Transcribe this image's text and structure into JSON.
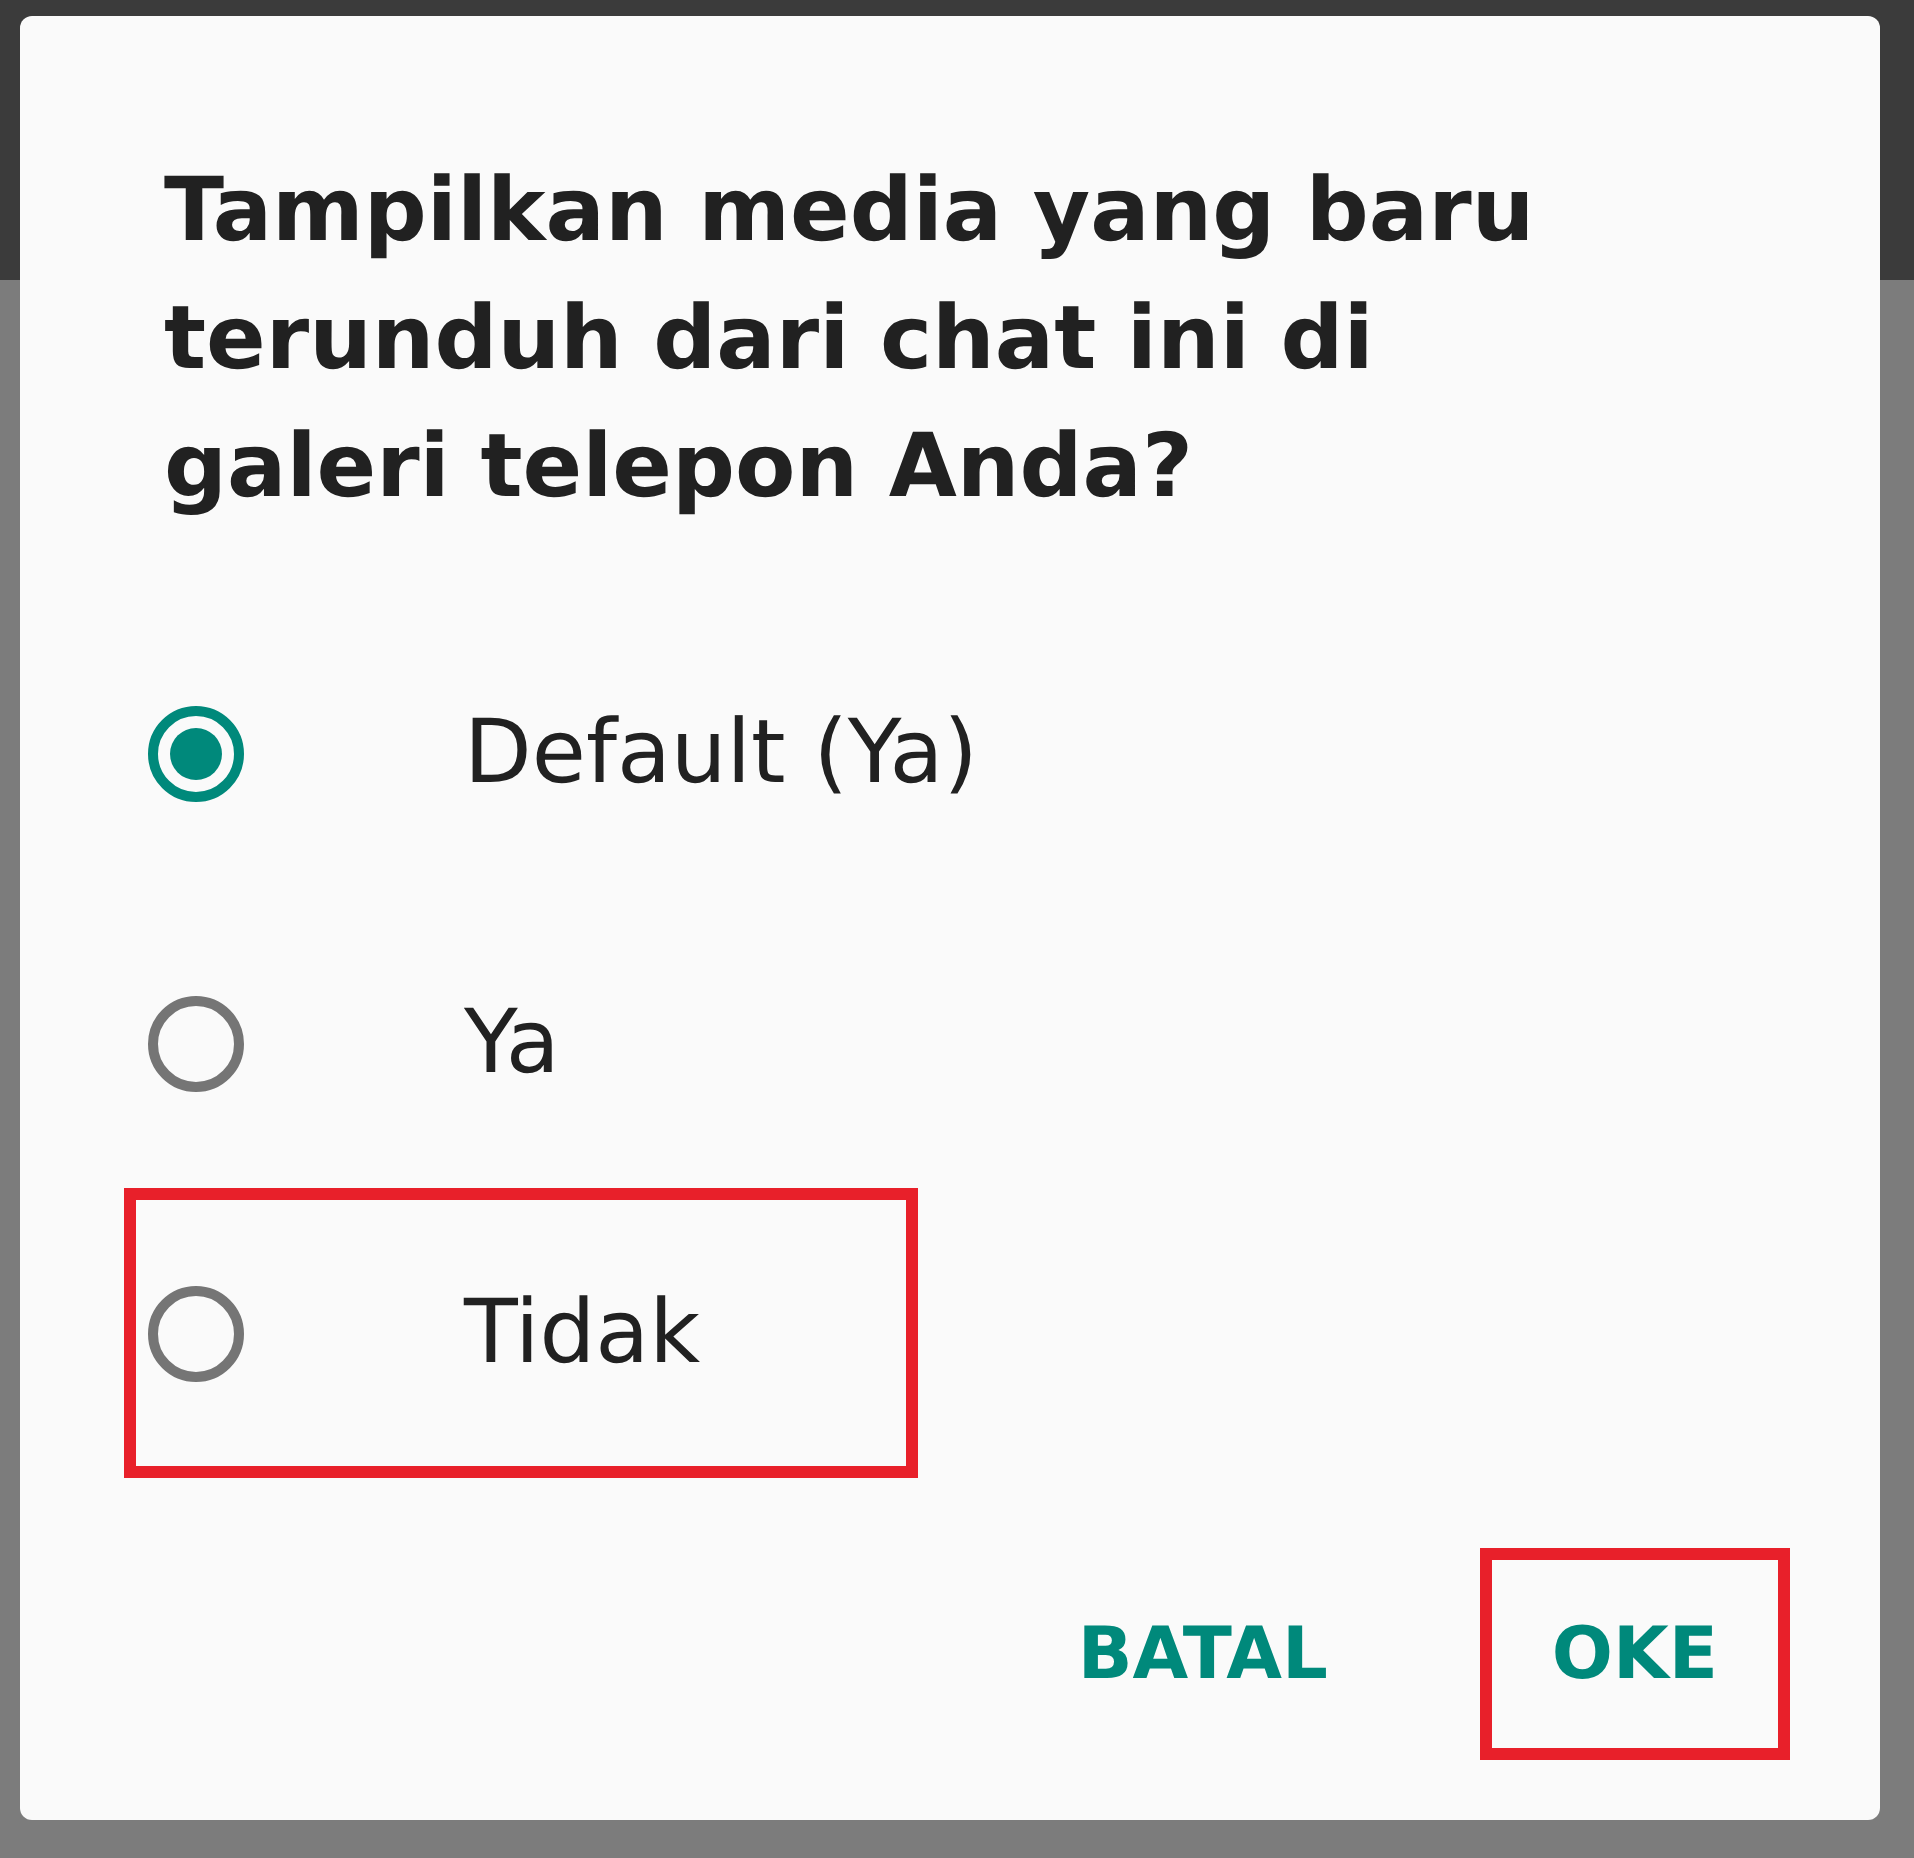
{
  "dialog": {
    "title": "Tampilkan media yang baru terunduh dari chat ini di galeri telepon Anda?",
    "options": [
      {
        "label": "Default (Ya)",
        "selected": true,
        "highlighted": false
      },
      {
        "label": "Ya",
        "selected": false,
        "highlighted": false
      },
      {
        "label": "Tidak",
        "selected": false,
        "highlighted": true
      }
    ],
    "buttons": [
      {
        "label": "BATAL",
        "highlighted": false
      },
      {
        "label": "OKE",
        "highlighted": true
      }
    ]
  }
}
